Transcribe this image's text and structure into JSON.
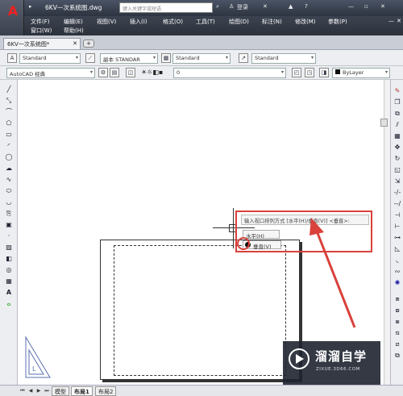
{
  "app": {
    "document_title": "6KV一次系统图.dwg",
    "search_placeholder": "键入关键字或短语",
    "login_label": "登录",
    "tab_label": "6KV一次系统图*"
  },
  "menu": [
    "文件(F)",
    "编辑(E)",
    "视图(V)",
    "插入(I)",
    "格式(O)",
    "工具(T)",
    "绘图(D)",
    "标注(N)",
    "修改(M)",
    "参数(P)",
    "窗口(W)",
    "帮助(H)"
  ],
  "toolbar1": {
    "text_style": "Standard",
    "dim_style": "副本 STANDAR",
    "table_style": "Standard",
    "multileader_style": "Standard"
  },
  "toolbar2": {
    "workspace": "AutoCAD 经典",
    "layer": "0",
    "linetype": "ByLayer"
  },
  "command": {
    "prompt": "输入视口排列方式 [水平(H)/垂直(V)] <垂直>:",
    "option_horizontal": "水平(H)",
    "option_vertical": "垂直(V)"
  },
  "status": {
    "tabs": [
      "模型",
      "布局1",
      "布局2"
    ],
    "active_tab": "布局1"
  },
  "watermark": {
    "name": "溜溜自学",
    "url": "ZIXUE.3D66.COM"
  },
  "colors": {
    "accent_red": "#d9413b",
    "title_dark": "#2e3440"
  }
}
